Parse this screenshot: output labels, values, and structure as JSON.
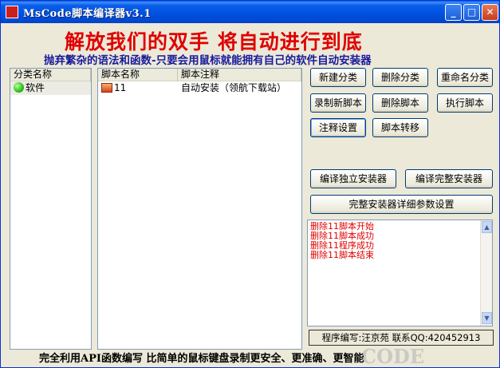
{
  "window": {
    "title": "MsCode脚本编译器v3.1",
    "controls": {
      "minimize": "_",
      "maximize": "□",
      "close": "✕"
    }
  },
  "banner": {
    "headline": "解放我们的双手   将自动进行到底",
    "subline": "抛弃繁杂的语法和函数-只要会用鼠标就能拥有自己的软件自动安装器"
  },
  "category_list": {
    "columns": [
      "分类名称"
    ],
    "rows": [
      {
        "name": "软件",
        "icon": "green-dot-icon"
      }
    ]
  },
  "script_list": {
    "columns": [
      "脚本名称",
      "脚本注释"
    ],
    "rows": [
      {
        "name": "11",
        "comment": "自动安装（领航下载站）",
        "icon": "script-icon"
      }
    ]
  },
  "buttons": {
    "new_category": "新建分类",
    "delete_category": "删除分类",
    "rename_category": "重命名分类",
    "record_script": "录制新脚本",
    "delete_script": "删除脚本",
    "run_script": "执行脚本",
    "comment_settings": "注释设置",
    "move_script": "脚本转移",
    "compile_standalone": "编译独立安装器",
    "compile_full": "编译完整安装器",
    "full_installer_settings": "完整安装器详细参数设置"
  },
  "log": {
    "lines": [
      "删除11脚本开始",
      "删除11脚本成功",
      "删除11程序成功",
      "删除11脚本结束"
    ]
  },
  "credit": "程序编写:汪京苑 联系QQ:420452913",
  "footer": "完全利用API函数编写 比简单的鼠标键盘录制更安全、更准确、更智能",
  "watermark": "CODE",
  "colors": {
    "headline": "#e00000",
    "subline": "#1a1a9c",
    "log_text": "#e00000",
    "titlebar": "#0a5ee8"
  }
}
